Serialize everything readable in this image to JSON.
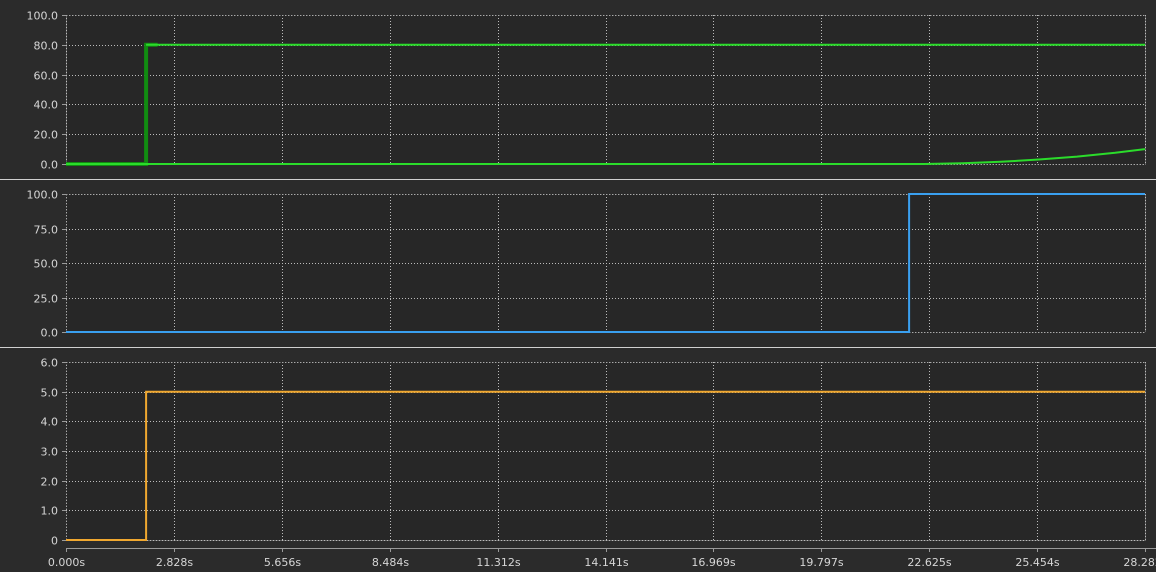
{
  "colors": {
    "background": "#2b2b2b",
    "plot_background": "#272727",
    "grid": "#bcbcbc",
    "frame": "#9a9a9a",
    "separator": "#d0d0d0",
    "text": "#d6d6d6"
  },
  "x_axis": {
    "unit_suffix": "s",
    "range": [
      0,
      28.282
    ],
    "tick_values": [
      0,
      2.828,
      5.656,
      8.484,
      11.312,
      14.141,
      16.969,
      19.797,
      22.625,
      25.454,
      28.282
    ],
    "tick_labels": [
      "0.000s",
      "2.828s",
      "5.656s",
      "8.484s",
      "11.312s",
      "14.141s",
      "16.969s",
      "19.797s",
      "22.625s",
      "25.454s",
      "28.282s"
    ]
  },
  "chart_data": [
    {
      "type": "line",
      "ylim": [
        0,
        100
      ],
      "y_ticks": [
        0,
        20,
        40,
        60,
        80,
        100
      ],
      "y_tick_labels": [
        "0.0",
        "20.0",
        "40.0",
        "60.0",
        "80.0",
        "100.0"
      ],
      "grid": true,
      "series": [
        {
          "color": "#118c11",
          "width": 4,
          "points": [
            [
              0,
              0
            ],
            [
              2.1,
              0
            ],
            [
              2.1,
              80
            ],
            [
              2.4,
              80
            ]
          ]
        },
        {
          "color": "#2bdc2b",
          "width": 2,
          "points": [
            [
              2.1,
              80
            ],
            [
              28.282,
              80
            ]
          ]
        },
        {
          "color": "#2bdc2b",
          "width": 2,
          "points": [
            [
              0,
              0
            ],
            [
              22.5,
              0
            ],
            [
              23.5,
              0.5
            ],
            [
              24.5,
              1.5
            ],
            [
              25.5,
              3
            ],
            [
              26.5,
              5
            ],
            [
              27.5,
              7.5
            ],
            [
              28.282,
              10
            ]
          ]
        }
      ]
    },
    {
      "type": "line",
      "ylim": [
        0,
        100
      ],
      "y_ticks": [
        0,
        25,
        50,
        75,
        100
      ],
      "y_tick_labels": [
        "0.0",
        "25.0",
        "50.0",
        "75.0",
        "100.0"
      ],
      "grid": true,
      "series": [
        {
          "color": "#3aa0f0",
          "width": 2,
          "points": [
            [
              0,
              0
            ],
            [
              22.1,
              0
            ],
            [
              22.1,
              100
            ],
            [
              28.282,
              100
            ]
          ]
        }
      ]
    },
    {
      "type": "line",
      "ylim": [
        0,
        6
      ],
      "y_ticks": [
        0,
        1,
        2,
        3,
        4,
        5,
        6
      ],
      "y_tick_labels": [
        "0",
        "1.0",
        "2.0",
        "3.0",
        "4.0",
        "5.0",
        "6.0"
      ],
      "grid": true,
      "series": [
        {
          "color": "#f0a830",
          "width": 2,
          "points": [
            [
              0,
              0
            ],
            [
              2.1,
              0
            ],
            [
              2.1,
              5
            ],
            [
              28.282,
              5
            ]
          ]
        }
      ]
    }
  ]
}
